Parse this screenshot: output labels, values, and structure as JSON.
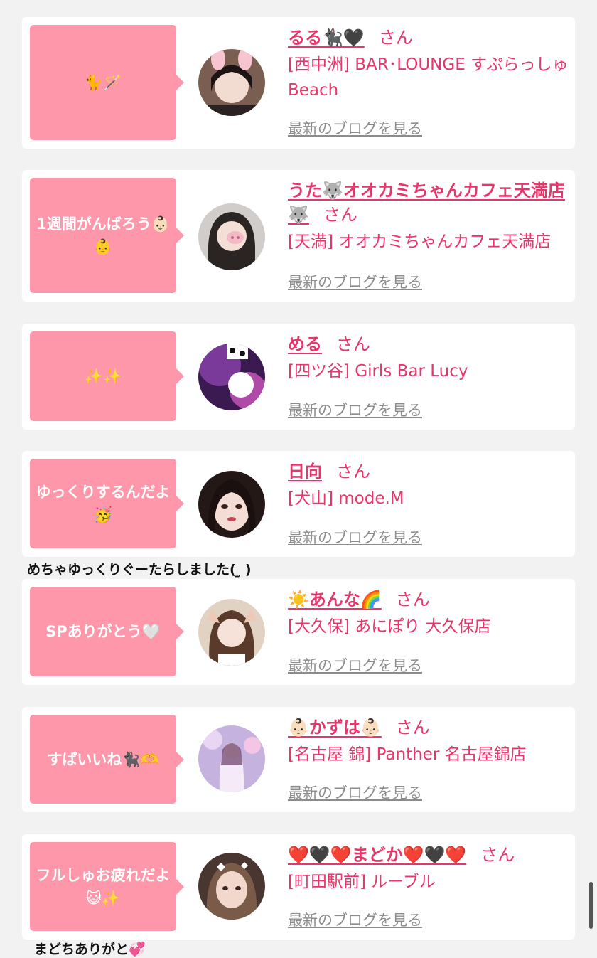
{
  "cards": [
    {
      "bubble": "🐈🪄",
      "name": "るる🐈‍⬛🖤",
      "san": "さん",
      "shop": "[西中洲] BAR･LOUNGE すぷらっしゅBeach",
      "blog": "最新のブログを見る",
      "avatar_bg": "#8c6a5e"
    },
    {
      "bubble": "1週間がんばろう👶🏻👶",
      "name": "うた🐺オオカミちゃんカフェ天満店🐺",
      "san": "さん",
      "shop": "[天満] オオカミちゃんカフェ天満店",
      "blog": "最新のブログを見る",
      "avatar_bg": "#c7c4c2"
    },
    {
      "bubble": "✨✨",
      "name": "める",
      "san": "さん",
      "shop": "[四ツ谷] Girls Bar Lucy",
      "blog": "最新のブログを見る",
      "avatar_bg": "#5a2a6e"
    },
    {
      "bubble": "ゆっくりするんだよ🥳",
      "name": "日向",
      "san": "さん",
      "shop": "[犬山] mode.M",
      "blog": "最新のブログを見る",
      "avatar_bg": "#3a2a26"
    },
    {
      "bubble": "SPありがとう🤍",
      "name": "☀️あんな🌈",
      "san": "さん",
      "shop": "[大久保] あにぽり 大久保店",
      "blog": "最新のブログを見る",
      "avatar_bg": "#d8c4b4"
    },
    {
      "bubble": "すぱいいね🐈‍⬛🫶",
      "name": "👶🏻かずは👶🏻",
      "san": "さん",
      "shop": "[名古屋 錦] Panther 名古屋錦店",
      "blog": "最新のブログを見る",
      "avatar_bg": "#c9b6de"
    },
    {
      "bubble": "フルしゅお疲れだよ😺✨",
      "name": "❤️🖤❤️まどか❤️🖤❤️",
      "san": "さん",
      "shop": "[町田駅前] ルーブル",
      "blog": "最新のブログを見る",
      "avatar_bg": "#5e4840"
    }
  ],
  "comments": {
    "after_card_4": "めちゃゆっくりぐーたらしました( ̫ )",
    "after_card_7": "まどちありがと💞"
  },
  "colors": {
    "page_bg": "#f2f2f2",
    "bubble": "#ff97ab",
    "accent_pink": "#e8366a",
    "link_gray": "#8c8c8c"
  }
}
